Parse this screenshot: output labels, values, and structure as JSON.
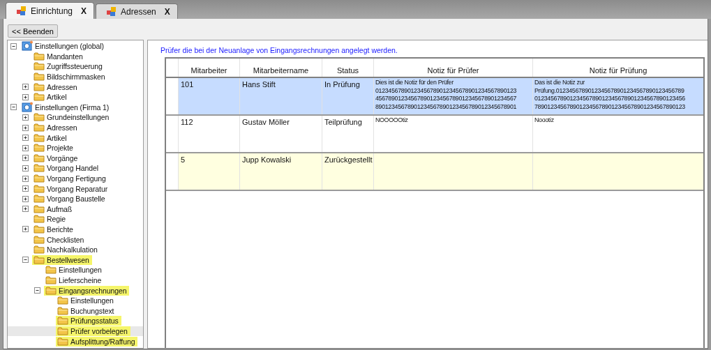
{
  "tabs": [
    {
      "label": "Einrichtung",
      "close": "X",
      "selected": true
    },
    {
      "label": "Adressen",
      "close": "X",
      "selected": false
    }
  ],
  "back_button": "<< Beenden",
  "tree": [
    {
      "label": "Einstellungen (global)",
      "kind": "root",
      "expanded": true,
      "highlighted": false,
      "selected": false,
      "children": [
        {
          "label": "Mandanten",
          "kind": "folder",
          "highlighted": false,
          "selected": false
        },
        {
          "label": "Zugriffssteuerung",
          "kind": "folder",
          "highlighted": false,
          "selected": false
        },
        {
          "label": "Bildschirmmasken",
          "kind": "folder",
          "highlighted": false,
          "selected": false
        },
        {
          "label": "Adressen",
          "kind": "folder",
          "expanded": false,
          "highlighted": false,
          "selected": false
        },
        {
          "label": "Artikel",
          "kind": "folder",
          "expanded": false,
          "highlighted": false,
          "selected": false
        }
      ]
    },
    {
      "label": "Einstellungen (Firma 1)",
      "kind": "root",
      "expanded": true,
      "highlighted": false,
      "selected": false,
      "children": [
        {
          "label": "Grundeinstellungen",
          "kind": "folder",
          "expanded": false,
          "highlighted": false,
          "selected": false
        },
        {
          "label": "Adressen",
          "kind": "folder",
          "expanded": false,
          "highlighted": false,
          "selected": false
        },
        {
          "label": "Artikel",
          "kind": "folder",
          "expanded": false,
          "highlighted": false,
          "selected": false
        },
        {
          "label": "Projekte",
          "kind": "folder",
          "expanded": false,
          "highlighted": false,
          "selected": false
        },
        {
          "label": "Vorgänge",
          "kind": "folder",
          "expanded": false,
          "highlighted": false,
          "selected": false
        },
        {
          "label": "Vorgang Handel",
          "kind": "folder",
          "expanded": false,
          "highlighted": false,
          "selected": false
        },
        {
          "label": "Vorgang Fertigung",
          "kind": "folder",
          "expanded": false,
          "highlighted": false,
          "selected": false
        },
        {
          "label": "Vorgang Reparatur",
          "kind": "folder",
          "expanded": false,
          "highlighted": false,
          "selected": false
        },
        {
          "label": "Vorgang Baustelle",
          "kind": "folder",
          "expanded": false,
          "highlighted": false,
          "selected": false
        },
        {
          "label": "Aufmaß",
          "kind": "folder",
          "expanded": false,
          "highlighted": false,
          "selected": false
        },
        {
          "label": "Regie",
          "kind": "folder",
          "highlighted": false,
          "selected": false
        },
        {
          "label": "Berichte",
          "kind": "folder",
          "expanded": false,
          "highlighted": false,
          "selected": false
        },
        {
          "label": "Checklisten",
          "kind": "folder",
          "highlighted": false,
          "selected": false
        },
        {
          "label": "Nachkalkulation",
          "kind": "folder",
          "highlighted": false,
          "selected": false
        },
        {
          "label": "Bestellwesen",
          "kind": "folder",
          "expanded": true,
          "highlighted": true,
          "selected": false,
          "children": [
            {
              "label": "Einstellungen",
              "kind": "folder",
              "highlighted": false,
              "selected": false
            },
            {
              "label": "Lieferscheine",
              "kind": "folder",
              "highlighted": false,
              "selected": false
            },
            {
              "label": "Eingangsrechnungen",
              "kind": "folder",
              "expanded": true,
              "highlighted": true,
              "selected": false,
              "children": [
                {
                  "label": "Einstellungen",
                  "kind": "folder",
                  "highlighted": false,
                  "selected": false
                },
                {
                  "label": "Buchungstext",
                  "kind": "folder",
                  "highlighted": false,
                  "selected": false
                },
                {
                  "label": "Prüfungsstatus",
                  "kind": "folder",
                  "highlighted": true,
                  "selected": false
                },
                {
                  "label": "Prüfer vorbelegen",
                  "kind": "folder",
                  "highlighted": true,
                  "selected": true
                },
                {
                  "label": "Aufsplittung/Raffung",
                  "kind": "folder",
                  "highlighted": true,
                  "selected": false
                }
              ]
            }
          ]
        }
      ]
    }
  ],
  "group_title": "Prüfer die bei der Neuanlage von Eingangsrechnungen angelegt werden.",
  "table": {
    "columns": [
      "Mitarbeiter",
      "Mitarbeitername",
      "Status",
      "Notiz für Prüfer",
      "Notiz für Prüfung"
    ],
    "rows": [
      {
        "selected": true,
        "highlighted": false,
        "cells": [
          [
            "101"
          ],
          [
            "Hans Stift"
          ],
          [
            "In Prüfung"
          ],
          [
            "Dies ist die Notiz für den Prüfer",
            "0123456789012345678901234567890123456789012​3",
            "45678901234567890123456789012345678901234567",
            "89012345678901234567890123456789012345678901"
          ],
          [
            "Das ist die Notiz zur",
            "Prüfung.0123456789012345678901234567890123456789",
            "01234567890123456789012345678901234567890123456",
            "78901234567890123456789012345678901234567890123"
          ]
        ]
      },
      {
        "selected": false,
        "highlighted": false,
        "cells": [
          [
            "112"
          ],
          [
            "Gustav Möller"
          ],
          [
            "Teilprüfung"
          ],
          [
            "NOOOOOtiz"
          ],
          [
            "Noootiz"
          ]
        ]
      },
      {
        "selected": false,
        "highlighted": true,
        "cells": [
          [
            "5"
          ],
          [
            "Jupp Kowalski"
          ],
          [
            "Zurückgestellt"
          ],
          [],
          []
        ]
      }
    ]
  }
}
